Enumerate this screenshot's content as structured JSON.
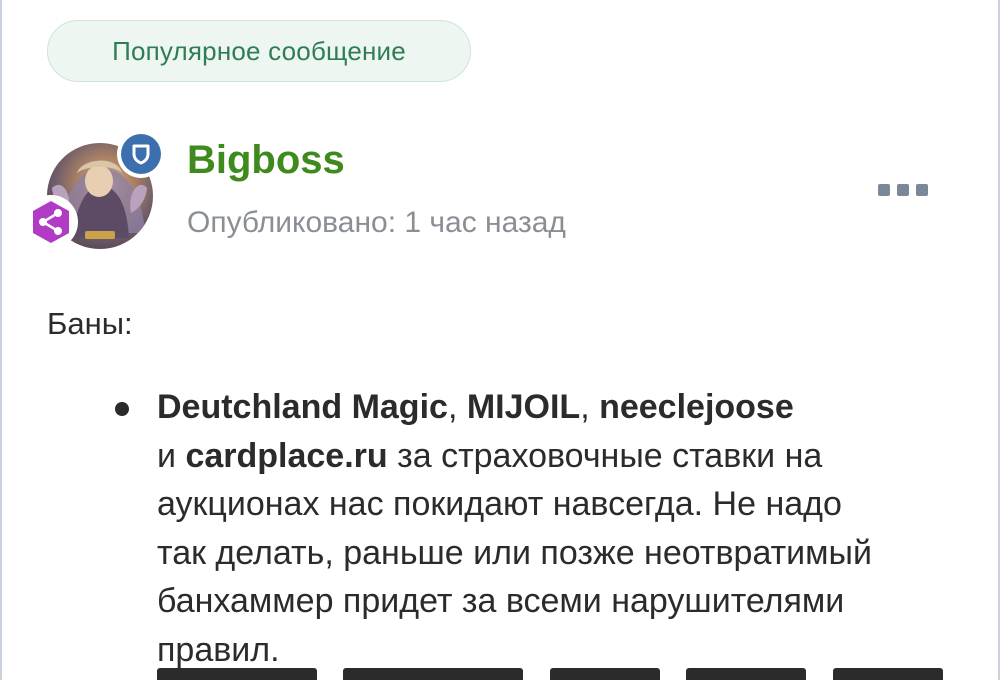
{
  "badge": {
    "label": "Популярное сообщение"
  },
  "post": {
    "author": "Bigboss",
    "published": "Опубликовано: 1 час назад",
    "avatar_icon": "avatar-image",
    "role_icon": "shield-icon",
    "level_icon": "share-node-icon",
    "menu_icon": "more-dots-icon"
  },
  "content": {
    "bans_label": "Баны:",
    "item": {
      "names_1": "Deutchland Magic",
      "sep_1": ", ",
      "names_2": "MIJOIL",
      "sep_2": ", ",
      "names_3": "neeclejoose",
      "conj": "и ",
      "names_4": "cardplace.ru",
      "line2_rest": " за страховочные ставки на",
      "line3": "аукционах нас покидают навсегда. Не надо",
      "line4": "так делать, раньше или позже неотвратимый",
      "line5": "банхаммер придет за всеми нарушителями",
      "line6": "правил."
    }
  },
  "colors": {
    "badge_text": "#2f7d55",
    "badge_bg": "#eef6f1",
    "author": "#3e8a1c",
    "meta": "#8a8f95",
    "role_badge": "#3b6fae",
    "level_badge": "#b13bc4"
  }
}
